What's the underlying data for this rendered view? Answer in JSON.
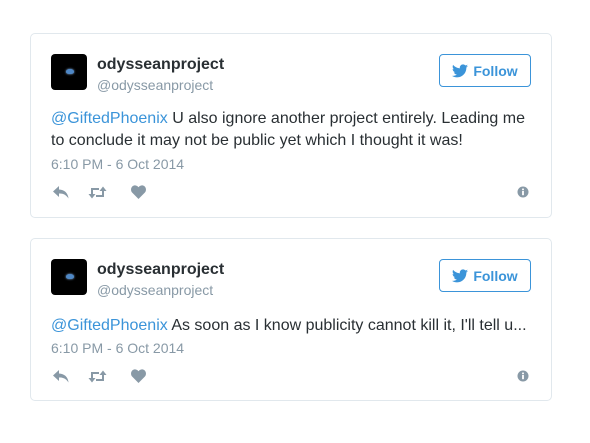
{
  "tweets": [
    {
      "display_name": "odysseanproject",
      "screen_name": "@odysseanproject",
      "follow_label": "Follow",
      "mention": "@GiftedPhoenix",
      "text": " U also ignore another project entirely. Leading me to conclude it may not be public yet which I thought it was!",
      "timestamp": "6:10 PM - 6 Oct 2014"
    },
    {
      "display_name": "odysseanproject",
      "screen_name": "@odysseanproject",
      "follow_label": "Follow",
      "mention": "@GiftedPhoenix",
      "text": " As soon as I know publicity cannot kill it, I'll tell u...",
      "timestamp": "6:10 PM - 6 Oct 2014"
    }
  ],
  "icons": {
    "avatar": "earth-photo-avatar",
    "follow": "twitter-bird-icon",
    "reply": "reply-icon",
    "retweet": "retweet-icon",
    "like": "heart-icon",
    "info": "info-icon"
  },
  "colors": {
    "link": "#3b94d9",
    "muted": "#8899a6",
    "icon": "#8899a6",
    "text": "#292f33",
    "border": "#e1e8ed"
  }
}
